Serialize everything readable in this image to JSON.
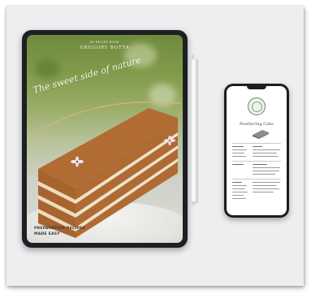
{
  "tablet": {
    "author_line": "BY RECIPE BOOK",
    "author_name": "GREGORY BOTTA",
    "title": "The sweet side of nature",
    "footer_line_1": "PREPARATION RECIPES",
    "footer_line_2": "MADE EASY"
  },
  "phone": {
    "title": "Feathering Cake"
  },
  "colors": {
    "card_bg": "#eceef0",
    "device_frame": "#1e1f22",
    "cake_crumb": "#b5703a",
    "cream_layer": "#efe3c8",
    "emblem_green": "#5e8a6a"
  },
  "icons": {
    "emblem": "leaf-badge-icon"
  }
}
